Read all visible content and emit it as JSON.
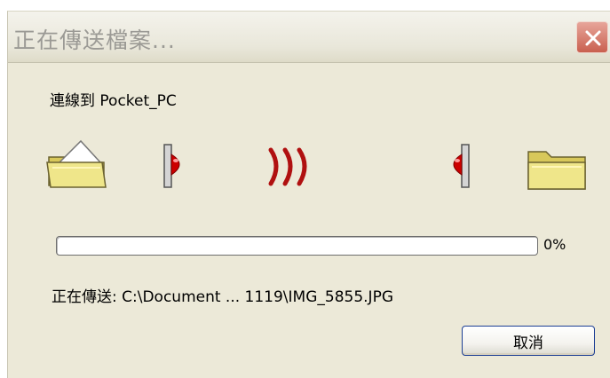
{
  "window": {
    "title": "正在傳送檔案..."
  },
  "connection_label": "連線到 Pocket_PC",
  "progress": {
    "percent_label": "0%",
    "value": 0
  },
  "status_label": "正在傳送: C:\\Document ... 1119\\IMG_5855.JPG",
  "buttons": {
    "cancel_label": "取消"
  },
  "icons": {
    "source": "open-folder-icon",
    "sender": "sender-device-icon",
    "signal": "signal-waves-icon",
    "receiver": "receiver-device-icon",
    "destination": "closed-folder-icon",
    "close": "close-icon"
  },
  "colors": {
    "folder": "#efe68a",
    "signal": "#b01010",
    "close_button": "#d2705f"
  }
}
